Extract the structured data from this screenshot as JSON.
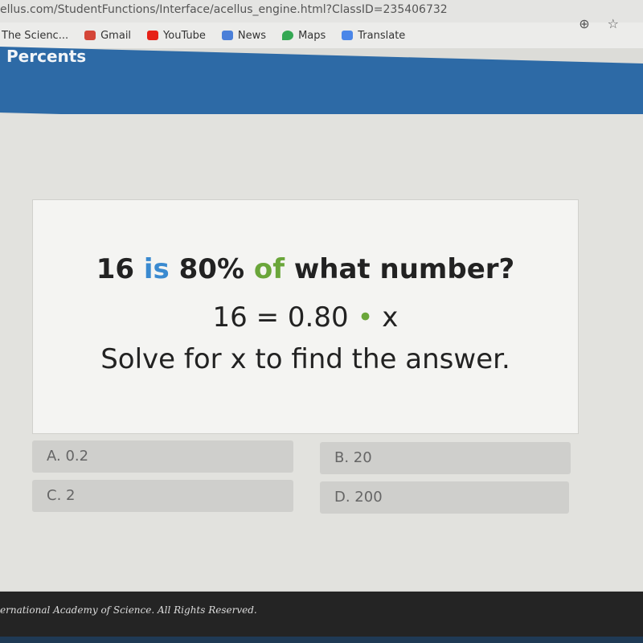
{
  "browser": {
    "url": "ellus.com/StudentFunctions/Interface/acellus_engine.html?ClassID=235406732",
    "bookmarks": [
      {
        "label": "The Scienc...",
        "icon": "none"
      },
      {
        "label": "Gmail",
        "icon": "gmail-icon",
        "color": "#d44638"
      },
      {
        "label": "YouTube",
        "icon": "youtube-icon",
        "color": "#e62117"
      },
      {
        "label": "News",
        "icon": "news-icon",
        "color": "#4a7fd8"
      },
      {
        "label": "Maps",
        "icon": "maps-icon",
        "color": "#34a853"
      },
      {
        "label": "Translate",
        "icon": "translate-icon",
        "color": "#4a86e8"
      }
    ]
  },
  "header": {
    "title": "Percents",
    "color": "#2d6aa6"
  },
  "question": {
    "part1": "16 ",
    "is": "is",
    "part2": " 80% ",
    "of": "of",
    "part3": " what number?",
    "equation_left": "16 = 0.80 ",
    "equation_dot": "•",
    "equation_right": " x",
    "instruction": "Solve for x to find the answer."
  },
  "answers": [
    {
      "label": "A. 0.2"
    },
    {
      "label": "B. 20"
    },
    {
      "label": "C. 2"
    },
    {
      "label": "D. 200"
    }
  ],
  "footer": {
    "text": "ernational Academy of Science.  All Rights Reserved."
  }
}
